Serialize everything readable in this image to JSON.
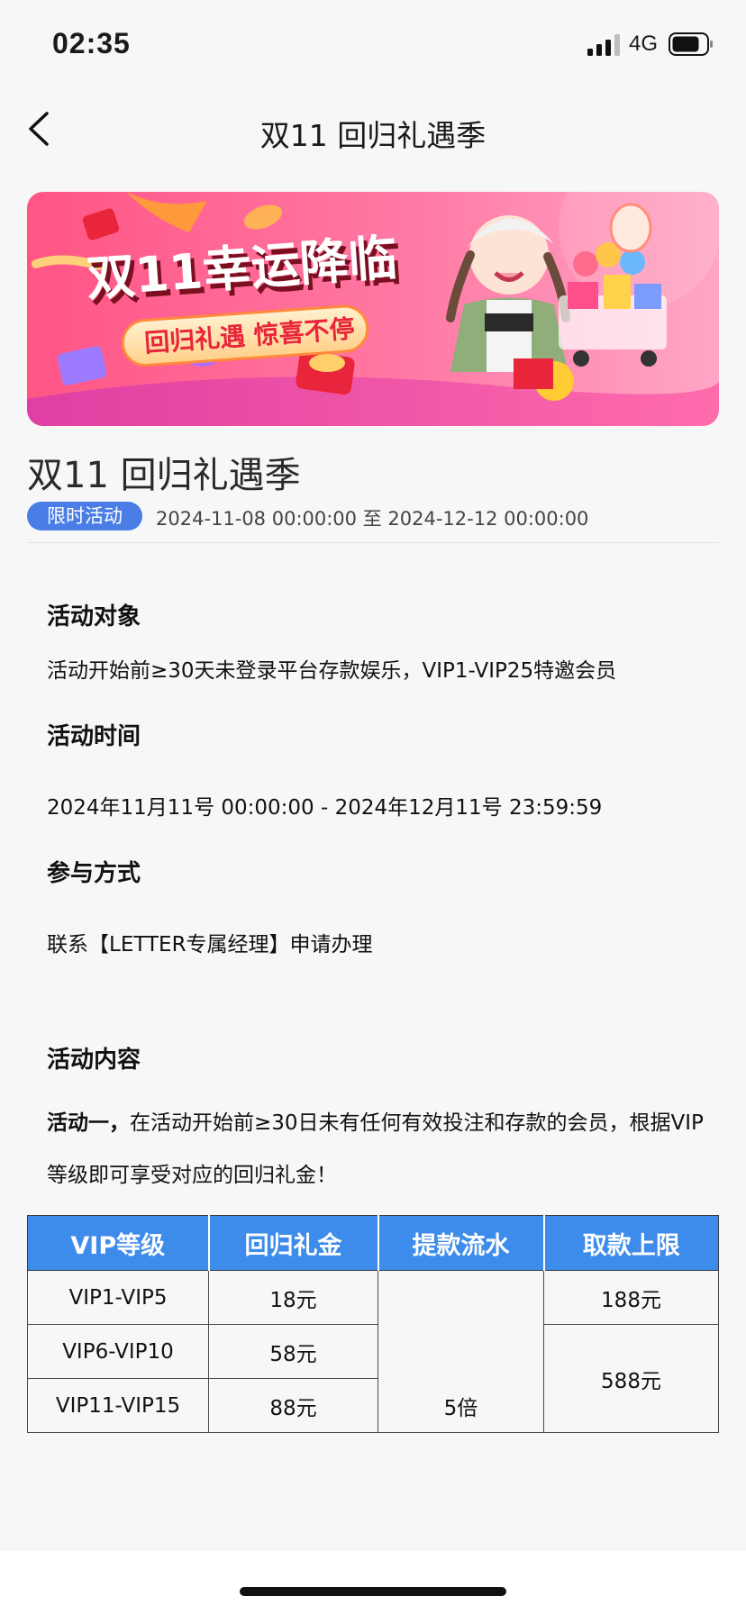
{
  "status_bar": {
    "time": "02:35",
    "network": "4G",
    "icons": [
      "cellular-signal-icon",
      "battery-icon"
    ]
  },
  "nav": {
    "title": "双11 回归礼遇季",
    "back_icon": "chevron-left-icon"
  },
  "banner": {
    "headline": "双11幸运降临",
    "subline": "回归礼遇 惊喜不停",
    "colors": {
      "bg_start": "#ff5a8a",
      "bg_end": "#ff9ec0",
      "ribbon": "#ffe2a8",
      "text_red": "#e8253a"
    }
  },
  "event": {
    "title": "双11 回归礼遇季",
    "badge": "限时活动",
    "date_range": "2024-11-08 00:00:00 至 2024-12-12 00:00:00",
    "badge_color": "#4a7ee6"
  },
  "sections": {
    "target_heading": "活动对象",
    "target_text": "活动开始前≥30天未登录平台存款娱乐，VIP1-VIP25特邀会员",
    "time_heading": "活动时间",
    "time_text": "2024年11月11号 00:00:00 - 2024年12月11号 23:59:59",
    "method_heading": "参与方式",
    "method_text": "联系【LETTER专属经理】申请办理",
    "content_heading": "活动内容",
    "activity_one_bold": "活动一，",
    "activity_one_text": "在活动开始前≥30日未有任何有效投注和存款的会员，根据VIP等级即可享受对应的回归礼金！"
  },
  "table": {
    "header_color": "#3d8bea",
    "headers": [
      "VIP等级",
      "回归礼金",
      "提款流水",
      "取款上限"
    ],
    "rows": [
      {
        "level": "VIP1-VIP5",
        "bonus": "18元",
        "limit": "188元"
      },
      {
        "level": "VIP6-VIP10",
        "bonus": "58元"
      },
      {
        "level": "VIP11-VIP15",
        "bonus": "88元"
      }
    ],
    "turnover": "5倍",
    "limit_merged": "588元"
  }
}
